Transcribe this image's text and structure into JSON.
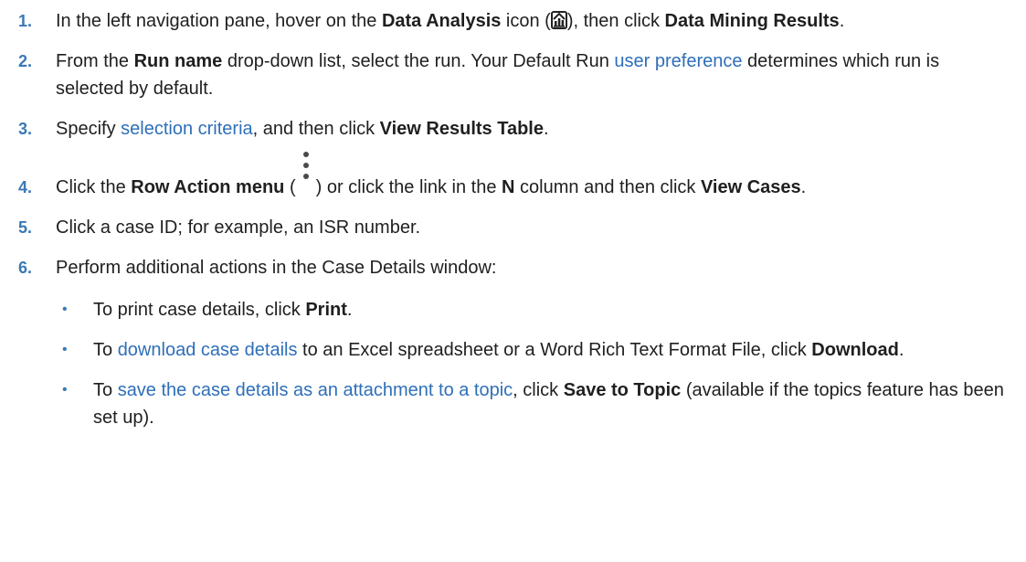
{
  "steps": [
    {
      "num": "1.",
      "t1": "In the left navigation pane, hover on the ",
      "b1": "Data Analysis",
      "t2": " icon (",
      "icon": "data-analysis-icon",
      "t3": "), then click ",
      "b2": "Data Mining Results",
      "t4": "."
    },
    {
      "num": "2.",
      "t1": "From the ",
      "b1": "Run name",
      "t2": " drop-down list, select the run. Your Default Run ",
      "link": "user preference",
      "t3": " determines which run is selected by default."
    },
    {
      "num": "3.",
      "t1": "Specify ",
      "link": "selection criteria",
      "t2": ", and then click ",
      "b1": "View Results Table",
      "t3": "."
    },
    {
      "num": "4.",
      "t1": "Click the ",
      "b1": "Row Action menu",
      "t2": " (",
      "icon": "kebab-menu-icon",
      "t3": ") or click the link in the ",
      "b2": "N",
      "t4": " column and then click ",
      "b3": "View Cases",
      "t5": "."
    },
    {
      "num": "5.",
      "t1": "Click a case ID; for example, an ISR number."
    },
    {
      "num": "6.",
      "t1": "Perform additional actions in the Case Details window:",
      "bullets": [
        {
          "mark": "•",
          "t1": "To print case details, click ",
          "b1": "Print",
          "t2": "."
        },
        {
          "mark": "•",
          "t1": "To ",
          "link": "download case details",
          "t2": " to an Excel spreadsheet or a Word Rich Text Format File, click ",
          "b1": "Download",
          "t3": "."
        },
        {
          "mark": "•",
          "t1": "To ",
          "link": "save the case details as an attachment to a topic",
          "t2": ", click ",
          "b1": "Save to Topic",
          "t3": " (available if the topics feature has been set up)."
        }
      ]
    }
  ],
  "colors": {
    "step_number": "#3a78b5",
    "link": "#2e6fb8",
    "text": "#1f1f1f"
  }
}
